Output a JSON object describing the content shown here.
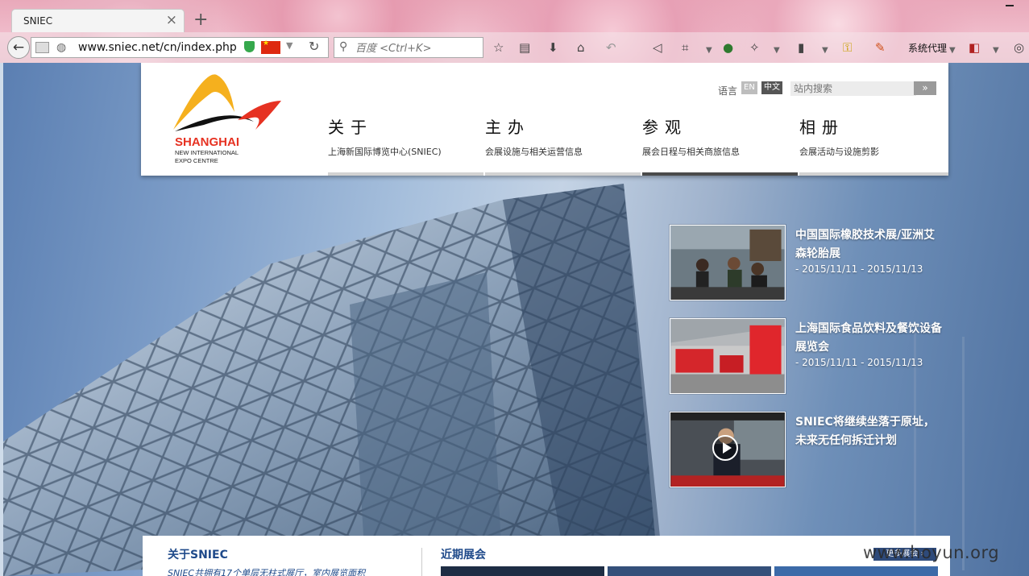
{
  "browser": {
    "tab_title": "SNIEC",
    "tab_close": "×",
    "new_tab": "+",
    "url": "www.sniec.net/cn/index.php",
    "search_placeholder": "百度 <Ctrl+K>",
    "proxy_label": "系统代理"
  },
  "site": {
    "logo": {
      "line1": "SHANGHAI",
      "line2": "NEW INTERNATIONAL",
      "line3": "EXPO CENTRE"
    },
    "lang_label": "语言",
    "lang_en": "EN",
    "lang_cn": "中文",
    "search_placeholder": "站内搜索",
    "search_button": "»",
    "nav": [
      {
        "title": "关于",
        "sub": "上海新国际博览中心(SNIEC)"
      },
      {
        "title": "主办",
        "sub": "会展设施与相关运营信息"
      },
      {
        "title": "参观",
        "sub": "展会日程与相关商旅信息"
      },
      {
        "title": "相册",
        "sub": "会展活动与设施剪影"
      }
    ],
    "news": [
      {
        "title": "中国国际橡胶技术展/亚洲艾森轮胎展",
        "date": "- 2015/11/11 - 2015/11/13"
      },
      {
        "title": "上海国际食品饮料及餐饮设备展览会",
        "date": "- 2015/11/11 - 2015/11/13"
      },
      {
        "title": "SNIEC将继续坐落于原址，未来无任何拆迁计划",
        "date": ""
      }
    ],
    "about_title": "关于SNIEC",
    "about_text": "SNIEC共拥有17个单层无柱式展厅，室内展览面积",
    "recent_title": "近期展会",
    "more_button": "更多展会 ›"
  },
  "watermark": "www.hoyun.org",
  "colors": {
    "brand_orange": "#f5b01e",
    "brand_red": "#e63222",
    "brand_black": "#111111",
    "title_blue": "#1f4a8a"
  }
}
